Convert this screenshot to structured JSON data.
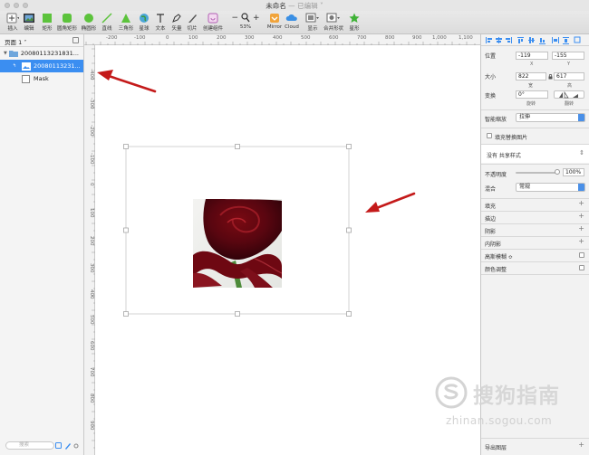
{
  "window": {
    "title": "未命名",
    "edited": " — 已编辑 ˅"
  },
  "toolbar": {
    "items": [
      {
        "label": "插入"
      },
      {
        "label": "编辑"
      },
      {
        "label": "矩形"
      },
      {
        "label": "圆角矩形"
      },
      {
        "label": "椭圆形"
      },
      {
        "label": "直线"
      },
      {
        "label": "三角形"
      },
      {
        "label": "星球"
      },
      {
        "label": "文本"
      },
      {
        "label": "矢量"
      },
      {
        "label": "切片"
      },
      {
        "label": "创建组件"
      },
      {
        "label": "53%"
      },
      {
        "label": "Mirror"
      },
      {
        "label": "Cloud"
      },
      {
        "label": "显示"
      },
      {
        "label": "合并形状"
      },
      {
        "label": "星形"
      }
    ],
    "zoom_minus": "−",
    "zoom_plus": "+"
  },
  "layers": {
    "page_label": "页面 1 ˅",
    "items": [
      {
        "label": "20080113231831..."
      },
      {
        "label": "20080113231..."
      },
      {
        "label": "Mask"
      }
    ],
    "search_placeholder": "搜索"
  },
  "ruler": {
    "h_ticks": [
      "-200",
      "-100",
      "0",
      "100",
      "200",
      "300",
      "400",
      "500",
      "600",
      "700",
      "800",
      "900",
      "1,000",
      "1,100"
    ],
    "v_ticks": [
      "-400",
      "-300",
      "-200",
      "-100",
      "0",
      "100",
      "200",
      "300",
      "400",
      "500",
      "600",
      "700",
      "800",
      "900"
    ]
  },
  "inspector": {
    "position_label": "位置",
    "x_value": "-119",
    "y_value": "-155",
    "x_label": "X",
    "y_label": "Y",
    "size_label": "大小",
    "width_value": "822",
    "height_value": "617",
    "width_label": "宽",
    "height_label": "高",
    "transform_label": "变换",
    "rotate_value": "0°",
    "rotate_label": "旋转",
    "flip_label": "翻转",
    "resize_label": "智能缩放",
    "resize_value": "拉伸",
    "fill_replace_label": "填充替换图片",
    "shared_style": "没有 共享样式",
    "opacity_label": "不透明度",
    "opacity_value": "100%",
    "opacity_fraction": 1.0,
    "blend_label": "混合",
    "blend_value": "常规",
    "sections": [
      {
        "label": "填充"
      },
      {
        "label": "描边"
      },
      {
        "label": "阴影"
      },
      {
        "label": "内阴影"
      },
      {
        "label": "高斯模糊 ≎"
      },
      {
        "label": "颜色调整"
      }
    ],
    "export_label": "导出图层"
  },
  "watermark": {
    "title": "搜狗指南",
    "url": "zhinan.sogou.com"
  },
  "colors": {
    "accent": "#3b8ef1",
    "arrow": "#c41a1a",
    "toolbar_green": "#5cc33c",
    "star": "#3fb236"
  }
}
